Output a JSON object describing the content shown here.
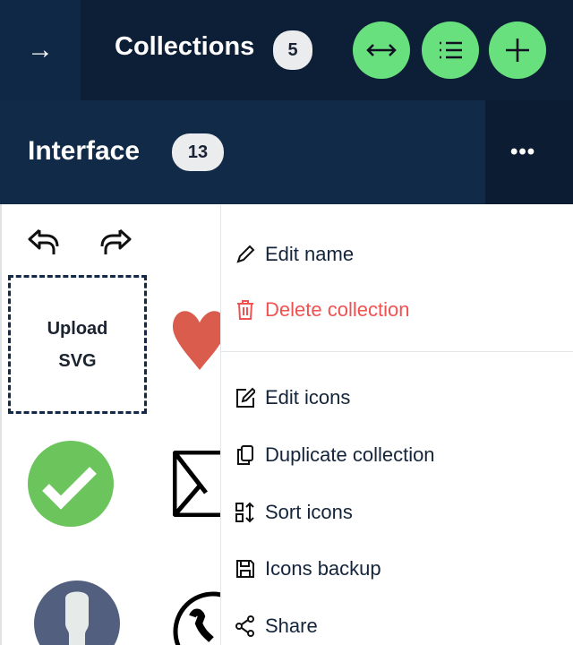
{
  "header": {
    "title": "Collections",
    "count": "5",
    "back_icon": "arrow-right-icon"
  },
  "toolbar": {
    "buttons": [
      "expand-horizontal-icon",
      "list-icon",
      "plus-icon"
    ]
  },
  "collection": {
    "name": "Interface",
    "count": "13",
    "more": "•••"
  },
  "editor": {
    "upload_line1": "Upload",
    "upload_line2": "SVG"
  },
  "menu": {
    "edit_name": "Edit name",
    "delete": "Delete collection",
    "edit_icons": "Edit icons",
    "duplicate": "Duplicate collection",
    "sort": "Sort icons",
    "backup": "Icons backup",
    "share": "Share"
  },
  "colors": {
    "accent": "#68e07e",
    "danger": "#f05252",
    "navy": "#0d1f36"
  }
}
